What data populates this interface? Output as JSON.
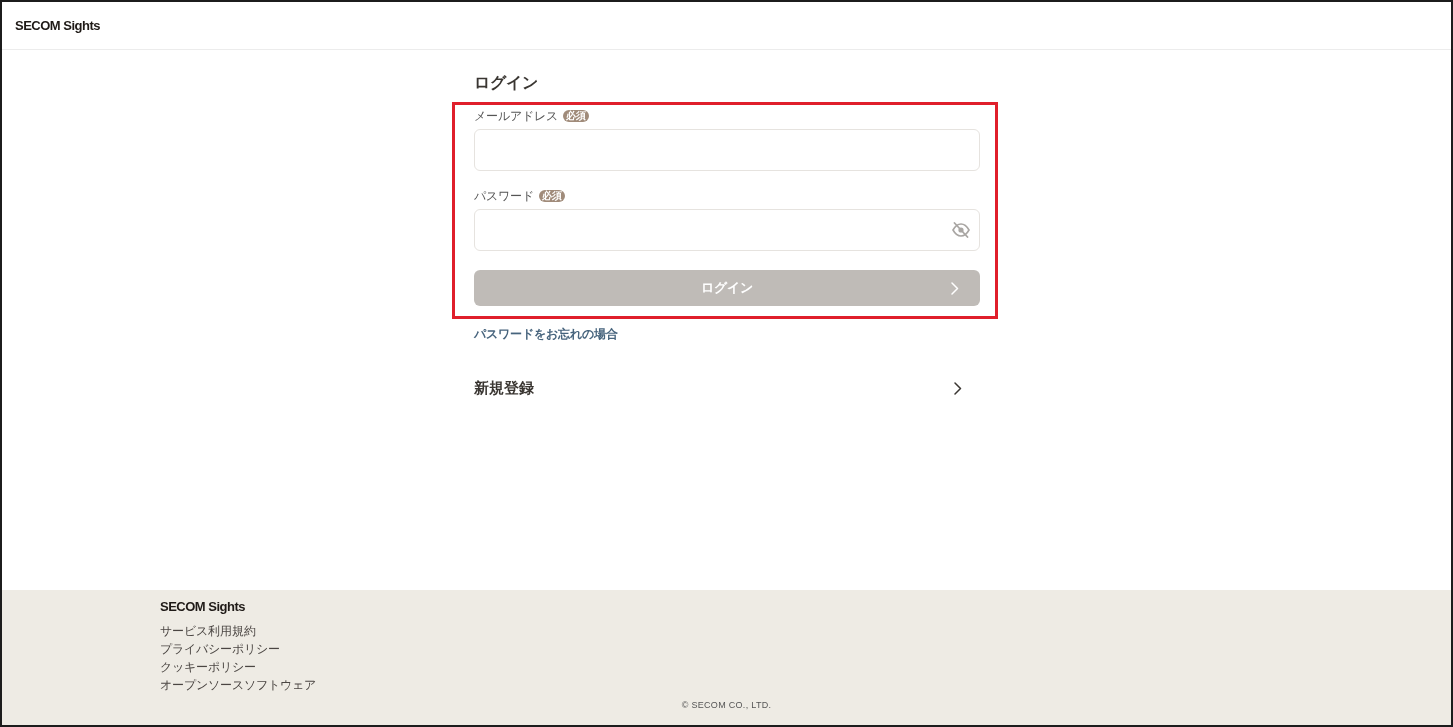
{
  "header": {
    "logo": "SECOM Sights"
  },
  "login": {
    "title": "ログイン",
    "annotation": {
      "kind": "frame"
    },
    "fields": [
      {
        "kind": "email",
        "label": "メールアドレス",
        "badge": "必須"
      },
      {
        "kind": "password",
        "label": "パスワード",
        "badge": "必須",
        "revealed": false
      }
    ],
    "submit": {
      "label": "ログイン",
      "disabled": true
    },
    "forgot_link": "パスワードをお忘れの場合",
    "register": {
      "label": "新規登録"
    }
  },
  "footer": {
    "logo": "SECOM Sights",
    "links": [
      "サービス利用規約",
      "プライバシーポリシー",
      "クッキーポリシー",
      "オープンソースソフトウェア"
    ],
    "copyright": "© SECOM CO., LTD."
  }
}
